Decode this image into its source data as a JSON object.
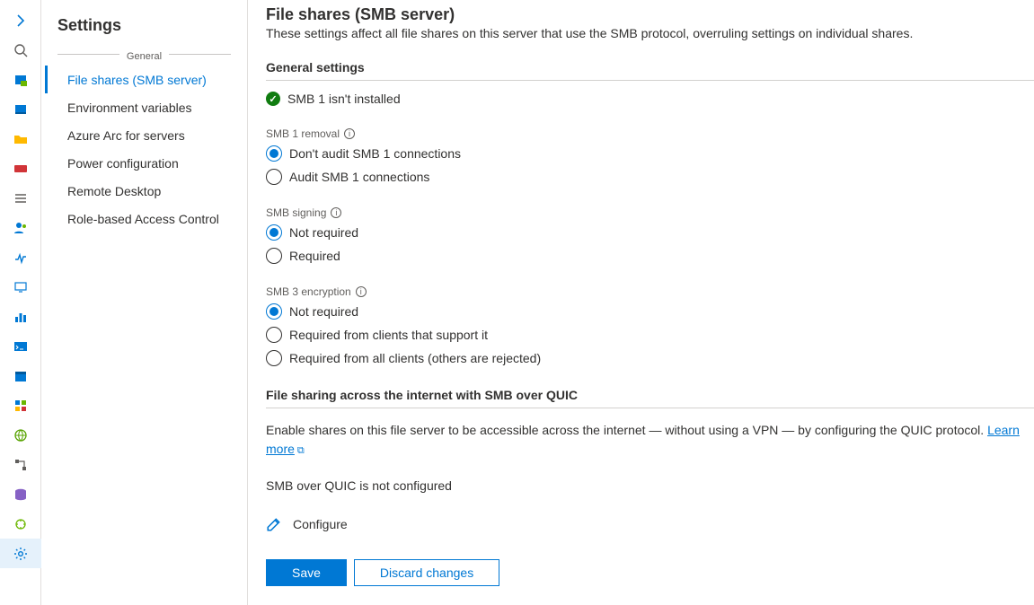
{
  "rail": {
    "items": [
      "chevron-icon",
      "search-icon",
      "server-icon",
      "computer-icon",
      "folder-icon",
      "card-icon",
      "list-icon",
      "users-icon",
      "process-icon",
      "monitor-icon",
      "chart-icon",
      "terminal-icon",
      "schedule-icon",
      "apps-icon",
      "network-icon",
      "workflow-icon",
      "database-icon",
      "extensions-icon",
      "settings-icon"
    ],
    "active_index": 18
  },
  "nav": {
    "title": "Settings",
    "group_label": "General",
    "items": [
      "File shares (SMB server)",
      "Environment variables",
      "Azure Arc for servers",
      "Power configuration",
      "Remote Desktop",
      "Role-based Access Control"
    ],
    "selected_index": 0
  },
  "page": {
    "title": "File shares (SMB server)",
    "subtitle": "These settings affect all file shares on this server that use the SMB protocol, overruling settings on individual shares."
  },
  "sections": {
    "general": {
      "heading": "General settings",
      "status_text": "SMB 1 isn't installed"
    },
    "quic": {
      "heading": "File sharing across the internet with SMB over QUIC",
      "description": "Enable shares on this file server to be accessible across the internet — without using a VPN — by configuring the QUIC protocol. ",
      "learn_more": "Learn more",
      "status": "SMB over QUIC is not configured",
      "configure_label": "Configure"
    }
  },
  "fields": {
    "smb1_removal": {
      "label": "SMB 1 removal",
      "options": [
        "Don't audit SMB 1 connections",
        "Audit SMB 1 connections"
      ],
      "selected": 0
    },
    "smb_signing": {
      "label": "SMB signing",
      "options": [
        "Not required",
        "Required"
      ],
      "selected": 0
    },
    "smb3_encryption": {
      "label": "SMB 3 encryption",
      "options": [
        "Not required",
        "Required from clients that support it",
        "Required from all clients (others are rejected)"
      ],
      "selected": 0
    }
  },
  "buttons": {
    "save": "Save",
    "discard": "Discard changes"
  }
}
